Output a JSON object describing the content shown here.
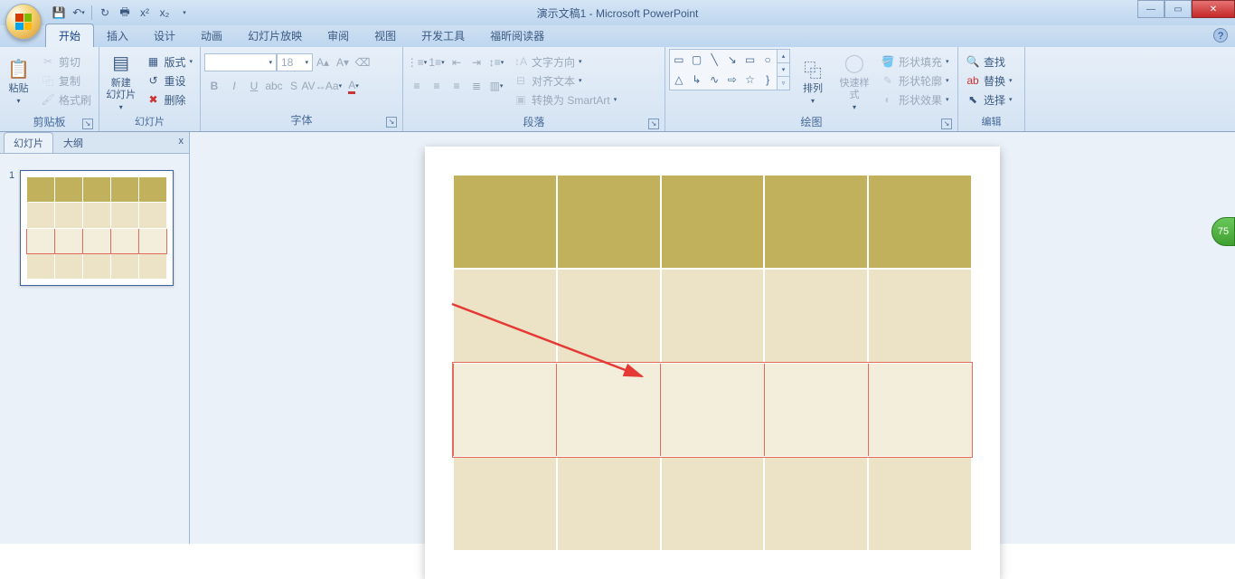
{
  "title": "演示文稿1 - Microsoft PowerPoint",
  "qat": {
    "save": "💾",
    "undo": "↶",
    "redo": "↻",
    "print": "🖶"
  },
  "tabs": [
    "开始",
    "插入",
    "设计",
    "动画",
    "幻灯片放映",
    "审阅",
    "视图",
    "开发工具",
    "福昕阅读器"
  ],
  "active_tab": "开始",
  "help": "?",
  "ribbon": {
    "clipboard": {
      "paste": "粘贴",
      "cut": "剪切",
      "copy": "复制",
      "format_painter": "格式刷",
      "label": "剪贴板"
    },
    "slides": {
      "new_slide": "新建\n幻灯片",
      "layout": "版式",
      "reset": "重设",
      "delete": "删除",
      "label": "幻灯片"
    },
    "font": {
      "size": "18",
      "label": "字体"
    },
    "paragraph": {
      "text_direction": "文字方向",
      "align_text": "对齐文本",
      "convert_smartart": "转换为 SmartArt",
      "label": "段落"
    },
    "drawing": {
      "arrange": "排列",
      "quick_styles": "快速样式",
      "shape_fill": "形状填充",
      "shape_outline": "形状轮廓",
      "shape_effects": "形状效果",
      "label": "绘图"
    },
    "editing": {
      "find": "查找",
      "replace": "替换",
      "select": "选择",
      "label": "编辑"
    }
  },
  "side": {
    "tabs": [
      "幻灯片",
      "大纲"
    ],
    "thumb_num": "1",
    "close": "x"
  },
  "badge": "75"
}
